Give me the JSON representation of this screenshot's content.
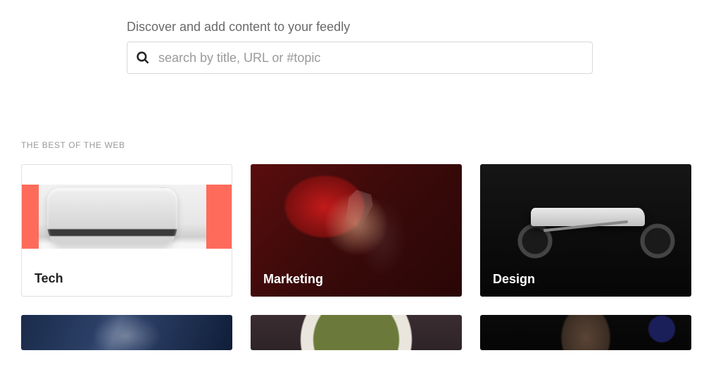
{
  "search": {
    "label": "Discover and add content to your feedly",
    "placeholder": "search by title, URL or #topic"
  },
  "section_heading": "THE BEST OF THE WEB",
  "cards": [
    {
      "label": "Tech",
      "theme": "light",
      "thumb": "thumb-tech"
    },
    {
      "label": "Marketing",
      "theme": "dark",
      "thumb": "thumb-marketing"
    },
    {
      "label": "Design",
      "theme": "dark",
      "thumb": "thumb-design"
    }
  ],
  "cards_row2": [
    {
      "thumb": "thumb-biz"
    },
    {
      "thumb": "thumb-food"
    },
    {
      "thumb": "thumb-news"
    }
  ]
}
